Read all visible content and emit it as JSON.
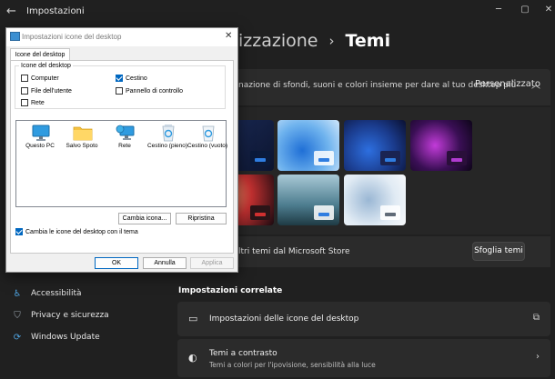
{
  "window": {
    "title": "Impostazioni",
    "breadcrumb_parent": "izzazione",
    "breadcrumb_separator": "›",
    "breadcrumb_current": "Temi"
  },
  "current_theme": {
    "description": "nazione di sfondi, suoni e colori insieme per dare al tuo desktop più",
    "value": "Personalizzato"
  },
  "store": {
    "text": "ltri temi dal Microsoft Store",
    "browse_label": "Sfoglia temi"
  },
  "sidebar": {
    "items": [
      {
        "label": "Accessibilità",
        "icon": "accessibility-icon"
      },
      {
        "label": "Privacy e sicurezza",
        "icon": "shield-icon"
      },
      {
        "label": "Windows Update",
        "icon": "update-icon"
      }
    ]
  },
  "related": {
    "title": "Impostazioni correlate",
    "items": [
      {
        "label": "Impostazioni delle icone del desktop",
        "sub": "",
        "icon": "monitor-icon",
        "trailing": "external-link-icon"
      },
      {
        "label": "Temi a contrasto",
        "sub": "Temi a colori per l'ipovisione, sensibilità alla luce",
        "icon": "contrast-icon",
        "trailing": "chevron-right-icon"
      }
    ]
  },
  "dialog": {
    "title": "Impostazioni icone del desktop",
    "tab": "Icone del desktop",
    "group_title": "Icone del desktop",
    "checkboxes": [
      {
        "label": "Computer",
        "checked": false
      },
      {
        "label": "Cestino",
        "checked": true
      },
      {
        "label": "File dell'utente",
        "checked": false
      },
      {
        "label": "Pannello di controllo",
        "checked": false
      },
      {
        "label": "Rete",
        "checked": false
      }
    ],
    "icons": [
      {
        "label": "Questo PC",
        "icon": "computer-icon"
      },
      {
        "label": "Salvo Spoto",
        "icon": "folder-icon"
      },
      {
        "label": "Rete",
        "icon": "network-icon"
      },
      {
        "label": "Cestino (pieno)",
        "icon": "recycle-bin-full-icon"
      },
      {
        "label": "Cestino (vuoto)",
        "icon": "recycle-bin-empty-icon"
      }
    ],
    "change_icon_label": "Cambia icona...",
    "restore_label": "Ripristina",
    "allow_themes_label": "Cambia le icone del desktop con il tema",
    "allow_themes_checked": true,
    "ok_label": "OK",
    "cancel_label": "Annulla",
    "apply_label": "Applica"
  },
  "colors": {
    "accent": "#0067c0",
    "background": "#202020"
  }
}
